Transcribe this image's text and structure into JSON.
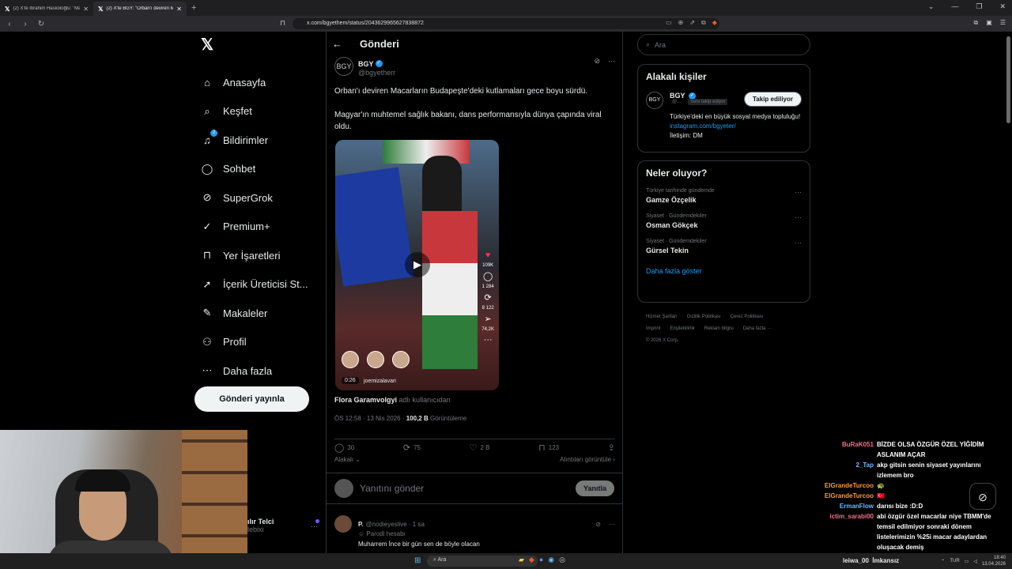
{
  "browser": {
    "tabs": [
      {
        "label": "(2) X'te İbrahim Haskoloğlu: \"Macarı..."
      },
      {
        "label": "(2) X'te BGY: \"Orban'ı deviren M..."
      }
    ],
    "url": "x.com/bgyethem/status/2043629965627838872"
  },
  "nav": {
    "items": [
      {
        "label": "Anasayfa",
        "icon": "home-icon"
      },
      {
        "label": "Keşfet",
        "icon": "search-icon"
      },
      {
        "label": "Bildirimler",
        "icon": "bell-icon",
        "badge": "2"
      },
      {
        "label": "Sohbet",
        "icon": "chat-icon"
      },
      {
        "label": "SuperGrok",
        "icon": "grok-icon"
      },
      {
        "label": "Premium+",
        "icon": "premium-icon"
      },
      {
        "label": "Yer İşaretleri",
        "icon": "bookmark-icon"
      },
      {
        "label": "İçerik Üreticisi St...",
        "icon": "rocket-icon"
      },
      {
        "label": "Makaleler",
        "icon": "article-icon"
      },
      {
        "label": "Profil",
        "icon": "profile-icon"
      },
      {
        "label": "Daha fazla",
        "icon": "more-icon"
      }
    ],
    "post_button": "Gönderi yayınla",
    "profile_name": "ılır Telci",
    "profile_handle": "lebixi"
  },
  "main": {
    "title": "Gönderi",
    "tweet": {
      "avatar": "BGY",
      "name": "BGY",
      "handle": "@bgyetherr",
      "text1": "Orban'ı deviren Macarların Budapeşte'deki kutlamaları gece boyu sürdü.",
      "text2": "Magyar'ın muhtemel sağlık bakanı, dans performansıyla dünya çapında viral oldu.",
      "video": {
        "likes": "109K",
        "comments": "1 284",
        "reposts": "8 122",
        "shares": "74,2K",
        "duration": "0:26",
        "username": "joemizalavari"
      },
      "credit_name": "Flora Garamvolgyi",
      "credit_suffix": "adlı kullanıcıdan",
      "time": "ÖS 12:58 · 13 Nis 2026 ·",
      "views": "100,2 B",
      "views_label": "Görüntüleme",
      "stats": {
        "replies": "30",
        "reposts": "75",
        "likes": "2 B",
        "bookmarks": "123"
      },
      "sort": "Alakalı",
      "quotes": "Alıntıları görüntüle"
    },
    "reply_placeholder": "Yanıtını gönder",
    "reply_button": "Yanıtla",
    "reply": {
      "name": "P.",
      "handle": "@nodieyeslive",
      "time": "· 1 sa",
      "parody": "Parodi hesabı",
      "text": "Muharrem İnce bir gün sen de böyle olacan"
    }
  },
  "right": {
    "search_placeholder": "Ara",
    "related_title": "Alakalı kişiler",
    "related": {
      "avatar": "BGY",
      "name": "BGY",
      "handle": "@...",
      "follows_you": "Seni takip ediyor",
      "follow_btn": "Takip ediliyor",
      "bio1": "Türkiye'deki en büyük sosyal medya topluluğu!",
      "bio_link": "instagram.com/bgyeter/",
      "bio2": "İletişim: DM"
    },
    "trends_title": "Neler oluyor?",
    "trends": [
      {
        "sub": "Türkiye tarihinde gündemde",
        "name": "Gamze Özçelik"
      },
      {
        "sub": "Siyaset · Gündemdekiler",
        "name": "Osman Gökçek"
      },
      {
        "sub": "Siyaset · Gündemdekiler",
        "name": "Gürsel Tekin"
      }
    ],
    "show_more": "Daha fazla göster",
    "footer": [
      "Hizmet Şartları",
      "Gizlilik Politikası",
      "Çerez Politikası",
      "Imprint",
      "Erişilebilirlik",
      "Reklam bilgisi",
      "Daha fazla ···",
      "© 2026 X Corp."
    ]
  },
  "chat": [
    {
      "user": "BuRaK051",
      "color": "#ff6b8a",
      "msg": "BİZDE OLSA ÖZGÜR ÖZEL YİĞİDİM ASLANIM AÇAR"
    },
    {
      "user": "2_Tap",
      "color": "#6fb8ff",
      "msg": "akp gitsin senin siyaset yayınlarını izlemem bro"
    },
    {
      "user": "ElGrandeTurcoo",
      "color": "#ff9a3c",
      "msg": "🐢"
    },
    {
      "user": "ElGrandeTurcoo",
      "color": "#ff9a3c",
      "msg": "🇹🇷"
    },
    {
      "user": "ErmanFlow",
      "color": "#6fb8ff",
      "msg": "darısı bize :D:D"
    },
    {
      "user": "ictim_sarabi00",
      "color": "#ff6b8a",
      "msg": "abi özgür özel macarlar niye TBMM'de temsil edilmiyor sonraki dönem listelerimizin %25i macar adaylardan oluşacak demiş"
    },
    {
      "user": "leiwa_00",
      "color": "#ffffff",
      "msg": "İmkansız"
    }
  ],
  "taskbar": {
    "search": "Ara",
    "lang": "TUR",
    "time": "18:40",
    "date": "13.04.2026"
  }
}
